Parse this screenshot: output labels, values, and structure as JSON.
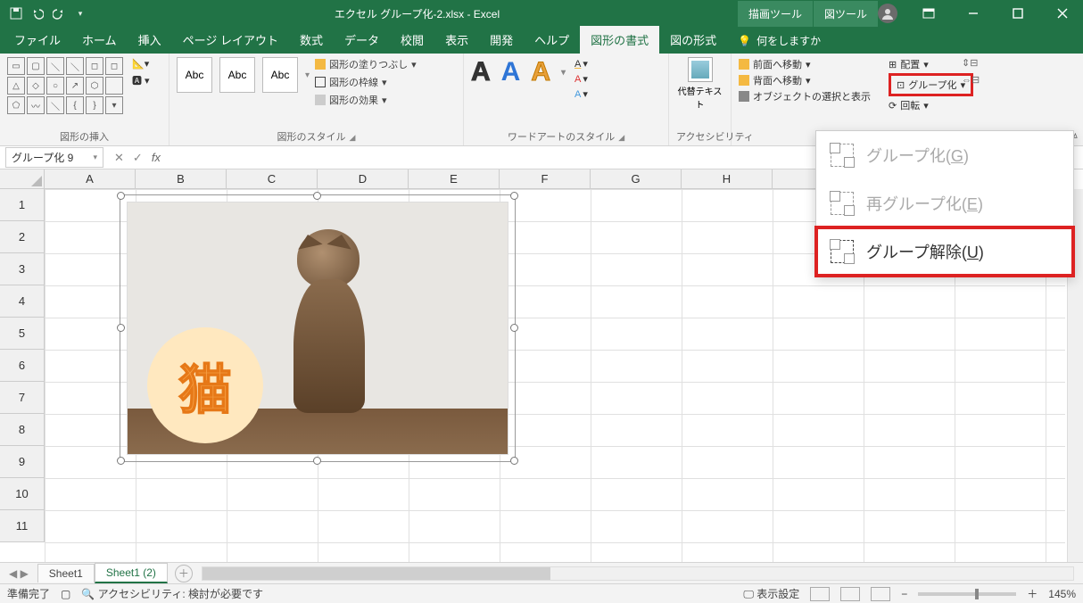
{
  "titlebar": {
    "filename": "エクセル グループ化-2.xlsx - Excel",
    "tool_tab1": "描画ツール",
    "tool_tab2": "図ツール"
  },
  "tabs": {
    "file": "ファイル",
    "home": "ホーム",
    "insert": "挿入",
    "pagelayout": "ページ レイアウト",
    "formulas": "数式",
    "data": "データ",
    "review": "校閲",
    "view": "表示",
    "developer": "開発",
    "help": "ヘルプ",
    "shapeformat": "図形の書式",
    "pictureformat": "図の形式",
    "tellme": "何をしますか"
  },
  "ribbon": {
    "insert_shapes": "図形の挿入",
    "shape_styles": "図形のスタイル",
    "sample": "Abc",
    "fill": "図形の塗りつぶし",
    "outline": "図形の枠線",
    "effects": "図形の効果",
    "wordart_styles": "ワードアートのスタイル",
    "wa": "A",
    "accessibility": "アクセシビリティ",
    "alt_text": "代替テキスト",
    "bring_forward": "前面へ移動",
    "send_backward": "背面へ移動",
    "selection_pane": "オブジェクトの選択と表示",
    "align": "配置",
    "group": "グループ化",
    "rotate": "回転"
  },
  "group_menu": {
    "group_pre": "グループ化(",
    "group_key": "G",
    "group_post": ")",
    "regroup_pre": "再グループ化(",
    "regroup_key": "E",
    "regroup_post": ")",
    "ungroup_pre": "グループ解除(",
    "ungroup_key": "U",
    "ungroup_post": ")"
  },
  "namebox": "グループ化 9",
  "columns": [
    "A",
    "B",
    "C",
    "D",
    "E",
    "F",
    "G",
    "H"
  ],
  "rows": [
    "1",
    "2",
    "3",
    "4",
    "5",
    "6",
    "7",
    "8",
    "9",
    "10",
    "11"
  ],
  "badge_text": "猫",
  "sheet_tabs": {
    "tab1": "Sheet1",
    "tab2": "Sheet1 (2)"
  },
  "status": {
    "ready": "準備完了",
    "accessibility": "アクセシビリティ: 検討が必要です",
    "display": "表示設定",
    "zoom": "145%"
  }
}
